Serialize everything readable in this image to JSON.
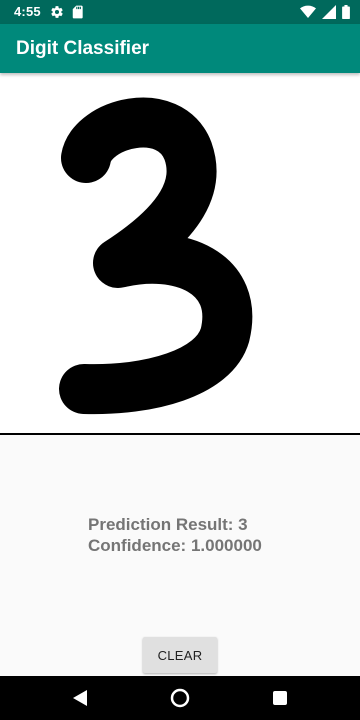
{
  "status_bar": {
    "time": "4:55",
    "left_icons": [
      "gear-icon",
      "sd-card-icon"
    ],
    "right_icons": [
      "wifi-icon",
      "cell-signal-icon",
      "battery-icon"
    ]
  },
  "app_bar": {
    "title": "Digit Classifier"
  },
  "canvas": {
    "drawn_digit": "3",
    "stroke_color": "#000000",
    "background": "#ffffff"
  },
  "results": {
    "prediction": "Prediction Result: 3",
    "confidence": "Confidence: 1.000000"
  },
  "actions": {
    "clear_label": "CLEAR"
  },
  "nav_bar": {
    "buttons": [
      "back-icon",
      "home-icon",
      "recents-icon"
    ]
  },
  "colors": {
    "primary": "#00897b",
    "primary_dark": "#00695c",
    "result_text": "#757575"
  }
}
